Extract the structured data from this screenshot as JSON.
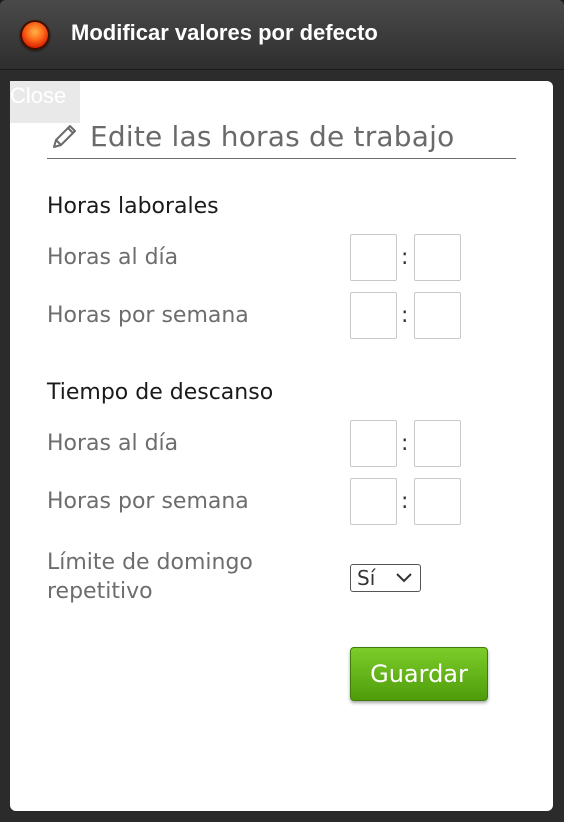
{
  "window": {
    "title": "Modificar valores por defecto",
    "close_text": "Close"
  },
  "form": {
    "heading": "Edite las horas de trabajo",
    "sections": [
      {
        "title": "Horas laborales",
        "rows": [
          {
            "label": "Horas al día",
            "hours": "",
            "minutes": ""
          },
          {
            "label": "Horas por semana",
            "hours": "",
            "minutes": ""
          }
        ]
      },
      {
        "title": "Tiempo de descanso",
        "rows": [
          {
            "label": "Horas al día",
            "hours": "",
            "minutes": ""
          },
          {
            "label": "Horas por semana",
            "hours": "",
            "minutes": ""
          }
        ]
      }
    ],
    "time_separator": ":",
    "sunday_limit": {
      "label_line1": "Límite de domingo",
      "label_line2": "repetitivo",
      "selected": "Sí"
    },
    "save_label": "Guardar"
  },
  "colors": {
    "save_button": "#5aa912",
    "title_bar": "#2e2e2e",
    "close_dot": "#e8330a"
  },
  "icons": {
    "heading": "pencil-icon",
    "window_close": "close-dot-icon",
    "select": "chevron-down-icon"
  }
}
